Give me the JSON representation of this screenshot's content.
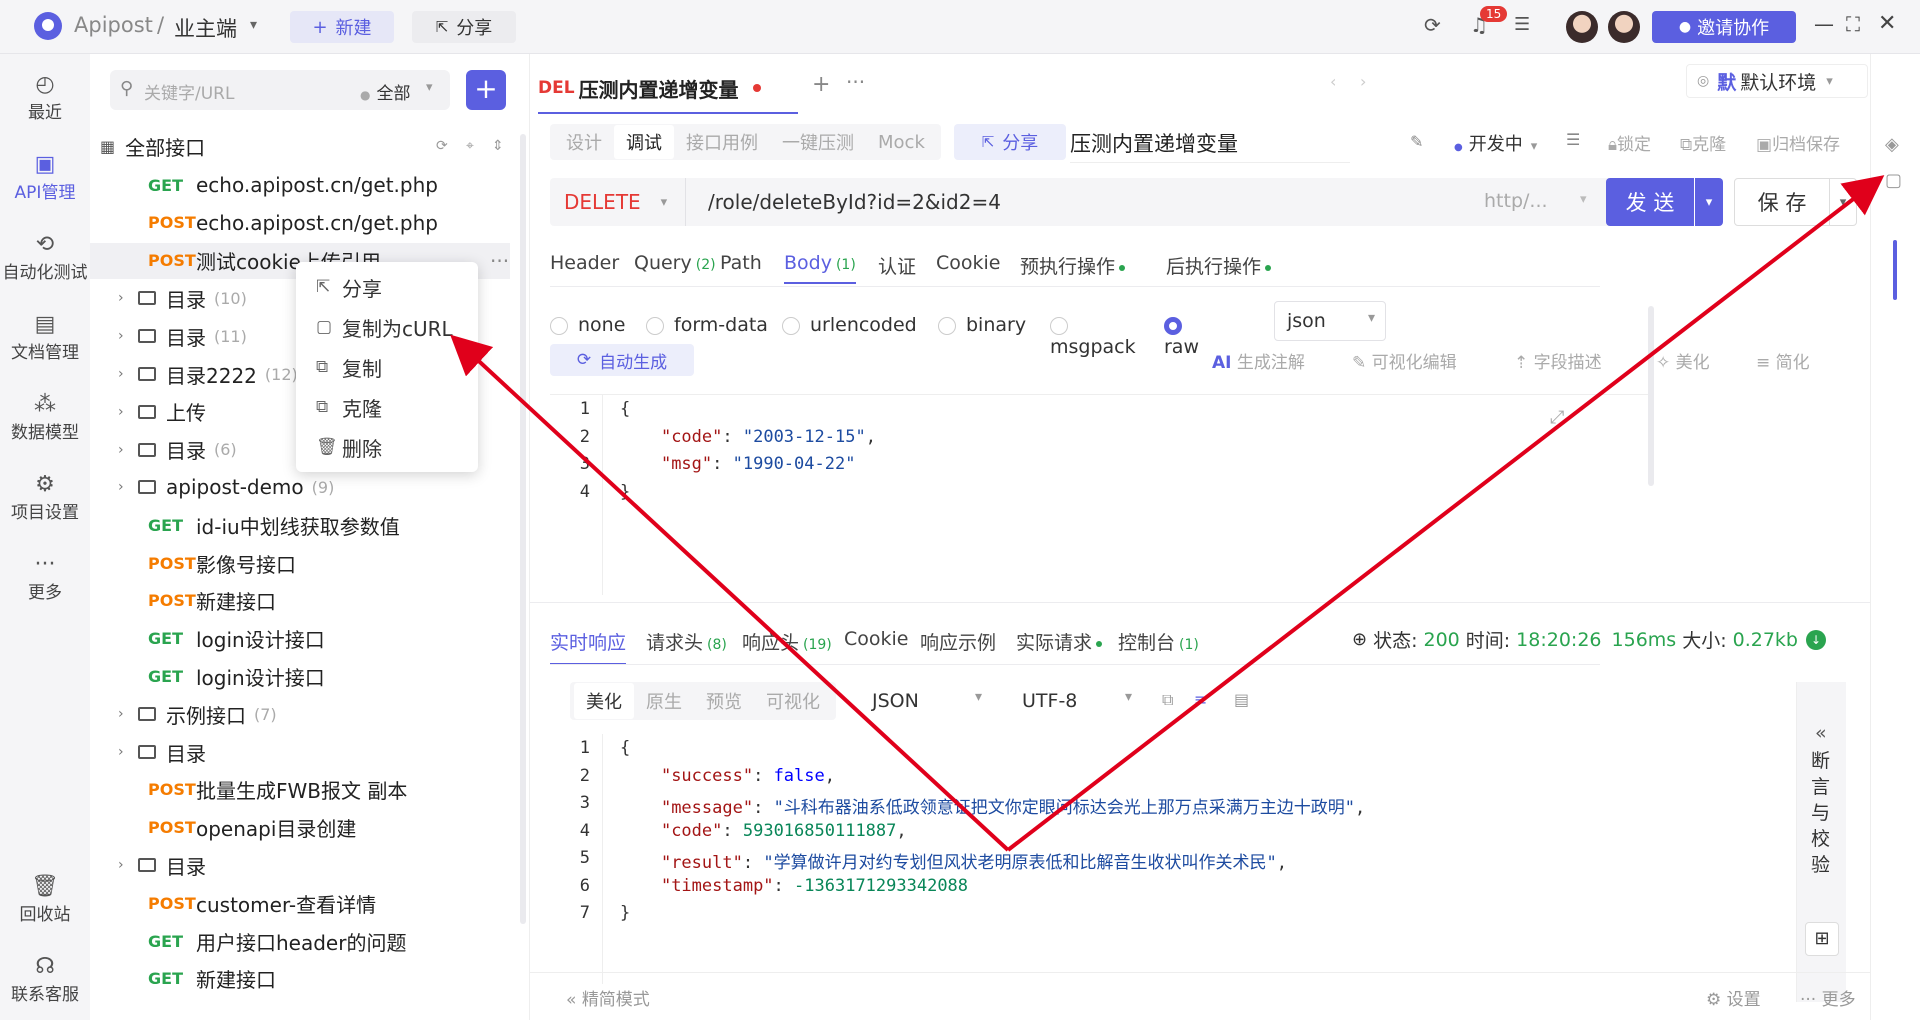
{
  "topbar": {
    "app_name": "Apipost",
    "separator": "/",
    "project": "业主端",
    "new_label": "新建",
    "share_label": "分享",
    "notif_count": "15",
    "invite_label": "邀请协作"
  },
  "rail": [
    {
      "label": "最近",
      "icon": "clock-icon"
    },
    {
      "label": "API管理",
      "icon": "api-icon"
    },
    {
      "label": "自动化测试",
      "icon": "flow-icon"
    },
    {
      "label": "文档管理",
      "icon": "doc-icon"
    },
    {
      "label": "数据模型",
      "icon": "model-icon"
    },
    {
      "label": "项目设置",
      "icon": "settings-icon"
    },
    {
      "label": "更多",
      "icon": "more-icon"
    },
    {
      "label": "回收站",
      "icon": "trash-icon"
    },
    {
      "label": "联系客服",
      "icon": "headset-icon"
    }
  ],
  "tree": {
    "search_placeholder": "关键字/URL",
    "filter": "全部",
    "root_label": "全部接口",
    "rows": [
      {
        "method": "GET",
        "label": "echo.apipost.cn/get.php",
        "count": ""
      },
      {
        "method": "POST",
        "label": "echo.apipost.cn/get.php",
        "count": ""
      },
      {
        "method": "POST",
        "label": "测试cookie上传引用",
        "count": ""
      },
      {
        "method": "folder",
        "label": "目录",
        "count": "(10)"
      },
      {
        "method": "folder",
        "label": "目录",
        "count": "(11)"
      },
      {
        "method": "folder",
        "label": "目录2222",
        "count": "(12)"
      },
      {
        "method": "folder",
        "label": "上传",
        "count": ""
      },
      {
        "method": "folder",
        "label": "目录",
        "count": "(6)"
      },
      {
        "method": "folder",
        "label": "apipost-demo",
        "count": "(9)"
      },
      {
        "method": "GET",
        "label": "id-iu中划线获取参数值",
        "count": ""
      },
      {
        "method": "POST",
        "label": "影像号接口",
        "count": ""
      },
      {
        "method": "POST",
        "label": "新建接口",
        "count": ""
      },
      {
        "method": "GET",
        "label": "login设计接口",
        "count": ""
      },
      {
        "method": "GET",
        "label": "login设计接口",
        "count": ""
      },
      {
        "method": "folder",
        "label": "示例接口",
        "count": "(7)"
      },
      {
        "method": "folder",
        "label": "目录",
        "count": ""
      },
      {
        "method": "POST",
        "label": "批量生成FWB报文 副本",
        "count": ""
      },
      {
        "method": "POST",
        "label": "openapi目录创建",
        "count": ""
      },
      {
        "method": "folder",
        "label": "目录",
        "count": ""
      },
      {
        "method": "POST",
        "label": "customer-查看详情",
        "count": ""
      },
      {
        "method": "GET",
        "label": "用户接口header的问题",
        "count": ""
      },
      {
        "method": "GET",
        "label": "新建接口",
        "count": ""
      }
    ]
  },
  "context_menu": [
    {
      "label": "分享",
      "icon": "share-icon"
    },
    {
      "label": "复制为cURL",
      "icon": "curl-icon"
    },
    {
      "label": "复制",
      "icon": "copy-icon"
    },
    {
      "label": "克隆",
      "icon": "clone-icon"
    },
    {
      "label": "删除",
      "icon": "trash-icon"
    }
  ],
  "request": {
    "tab_method": "DEL",
    "tab_title": "压测内置递增变量",
    "env": "默认环境",
    "mode_tabs": [
      "设计",
      "调试",
      "接口用例",
      "一键压测",
      "Mock"
    ],
    "share_label": "分享",
    "name": "压测内置递增变量",
    "status": "开发中",
    "actions": [
      "锁定",
      "克隆",
      "归档保存"
    ],
    "method": "DELETE",
    "url": "/role/deleteById?id=2&id2=4",
    "base_url": "http/...",
    "send_label": "发 送",
    "save_label": "保 存",
    "param_tabs": [
      {
        "label": "Header",
        "sub": ""
      },
      {
        "label": "Query",
        "sub": "(2)"
      },
      {
        "label": "Path",
        "sub": ""
      },
      {
        "label": "Body",
        "sub": "(1)"
      },
      {
        "label": "认证",
        "sub": ""
      },
      {
        "label": "Cookie",
        "sub": ""
      },
      {
        "label": "预执行操作",
        "sub": ""
      },
      {
        "label": "后执行操作",
        "sub": ""
      }
    ],
    "body_types": [
      "none",
      "form-data",
      "urlencoded",
      "binary",
      "msgpack",
      "raw"
    ],
    "raw_format": "json",
    "auto_gen": "自动生成",
    "body_tools": [
      "生成注解",
      "可视化编辑",
      "字段描述",
      "美化",
      "简化"
    ],
    "body_lines": [
      "{",
      "    \"code\": \"2003-12-15\",",
      "    \"msg\": \"1990-04-22\"",
      "}"
    ]
  },
  "response": {
    "tabs": [
      {
        "label": "实时响应",
        "sub": ""
      },
      {
        "label": "请求头",
        "sub": "(8)"
      },
      {
        "label": "响应头",
        "sub": "(19)"
      },
      {
        "label": "Cookie",
        "sub": ""
      },
      {
        "label": "响应示例",
        "sub": ""
      },
      {
        "label": "实际请求",
        "sub": ""
      },
      {
        "label": "控制台",
        "sub": "(1)"
      }
    ],
    "status_label": "状态:",
    "status": "200",
    "time_label": "时间:",
    "time": "18:20:26",
    "duration": "156ms",
    "size_label": "大小:",
    "size": "0.27kb",
    "view_tabs": [
      "美化",
      "原生",
      "预览",
      "可视化"
    ],
    "format": "JSON",
    "encoding": "UTF-8",
    "side_label": "断言与校验",
    "lines": [
      "{",
      "    \"success\": false,",
      "    \"message\": \"斗科布器油系低政领意证把文你定眼问标达会光上那万点采满万主边十政明\",",
      "    \"code\": 593016850111887,",
      "    \"result\": \"学算做许月对约专划但风状老明原表低和比解音生收状叫作关术民\",",
      "    \"timestamp\": -1363171293342088",
      "}"
    ]
  },
  "footer": {
    "mode": "精简模式",
    "settings": "设置",
    "more": "更多"
  },
  "colors": {
    "accent": "#5b5fe0",
    "delete": "#e53935",
    "get": "#2aa44f",
    "post": "#f57c00",
    "arrow": "#e0001b"
  }
}
